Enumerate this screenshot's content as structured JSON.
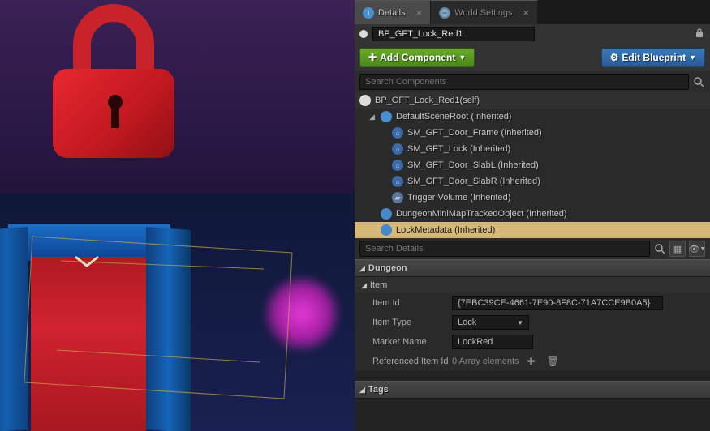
{
  "tabs": {
    "details": "Details",
    "world": "World Settings"
  },
  "actor": {
    "name": "BP_GFT_Lock_Red1"
  },
  "buttons": {
    "add_component": "Add Component",
    "edit_blueprint": "Edit Blueprint"
  },
  "search": {
    "components_placeholder": "Search Components",
    "details_placeholder": "Search Details"
  },
  "tree": {
    "self": "BP_GFT_Lock_Red1(self)",
    "root": "DefaultSceneRoot (Inherited)",
    "mesh1": "SM_GFT_Door_Frame (Inherited)",
    "mesh2": "SM_GFT_Lock (Inherited)",
    "mesh3": "SM_GFT_Door_SlabL (Inherited)",
    "mesh4": "SM_GFT_Door_SlabR (Inherited)",
    "trigger": "Trigger Volume (Inherited)",
    "minimap": "DungeonMiniMapTrackedObject (Inherited)",
    "lockmeta": "LockMetadata (Inherited)"
  },
  "categories": {
    "dungeon": "Dungeon",
    "item": "Item",
    "tags": "Tags"
  },
  "props": {
    "item_id_label": "Item Id",
    "item_id_value": "{7EBC39CE-4661-7E90-8F8C-71A7CCE9B0A5}",
    "item_type_label": "Item Type",
    "item_type_value": "Lock",
    "marker_name_label": "Marker Name",
    "marker_name_value": "LockRed",
    "ref_id_label": "Referenced Item Id",
    "ref_id_value": "0 Array elements"
  }
}
